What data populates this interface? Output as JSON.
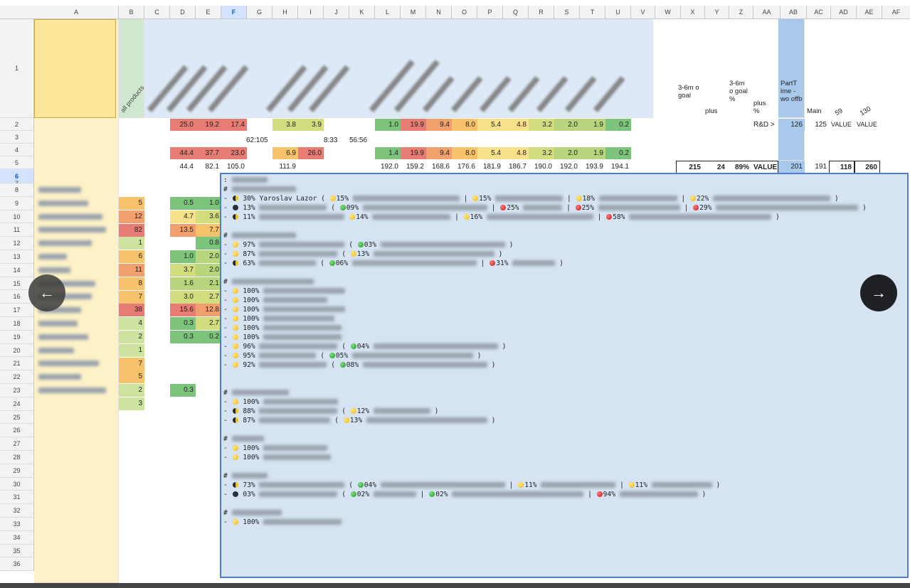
{
  "columns": [
    "A",
    "B",
    "C",
    "D",
    "E",
    "F",
    "G",
    "H",
    "I",
    "J",
    "K",
    "L",
    "M",
    "N",
    "O",
    "P",
    "Q",
    "R",
    "S",
    "T",
    "U",
    "V",
    "W",
    "X",
    "Y",
    "Z",
    "AA",
    "AB",
    "AC",
    "AD",
    "AE",
    "AF"
  ],
  "selected_column": "F",
  "rows": [
    "1",
    "2",
    "3",
    "4",
    "5",
    "6",
    "7",
    "8",
    "9",
    "10",
    "11",
    "12",
    "13",
    "14",
    "15",
    "16",
    "17",
    "18",
    "19",
    "20",
    "21",
    "22",
    "23",
    "24",
    "25",
    "26",
    "27",
    "28",
    "29",
    "30",
    "31",
    "32",
    "33",
    "34",
    "35",
    "36"
  ],
  "selected_row": "6",
  "header": {
    "b_rotated": "all products",
    "x": "3-6m o goal",
    "y": "plus",
    "z": "3-6m o goal %",
    "aa": "plus %",
    "ab": "PartT ime - wo offb",
    "ac": "Main",
    "ad": "59",
    "ae": "130"
  },
  "row2": {
    "values": [
      "25.0",
      "19.2",
      "17.4",
      "",
      "3.8",
      "3.9",
      "",
      "",
      "1.0",
      "19.9",
      "9.4",
      "8.0",
      "5.4",
      "4.8",
      "3.2",
      "2.0",
      "1.9",
      "0.2"
    ],
    "aa": "R&D >",
    "ab": "126",
    "ac": "125",
    "ad": "VALUE",
    "ae": "VALUE"
  },
  "row3": {
    "g": "62:105",
    "j": "8:33",
    "k": "56:56"
  },
  "row4": {
    "values": [
      "44.4",
      "37.7",
      "23.0",
      "",
      "6.9",
      "26.0",
      "",
      "",
      "1.4",
      "19.9",
      "9.4",
      "8.0",
      "5.4",
      "4.8",
      "3.2",
      "2.0",
      "1.9",
      "0.2"
    ]
  },
  "row5": {
    "values": [
      "44.4",
      "82.1",
      "105.0",
      "",
      "111.9",
      "",
      "",
      "",
      "192.0",
      "159.2",
      "168.6",
      "176.6",
      "181.9",
      "186.7",
      "190.0",
      "192.0",
      "193.9",
      "194.1"
    ],
    "x": "215",
    "y": "24",
    "z": "89%",
    "aa": "VALUE",
    "ab": "201",
    "ac": "191",
    "ad": "118",
    "ae": "260"
  },
  "b_values": [
    "5",
    "12",
    "82",
    "1",
    "6",
    "11",
    "8",
    "7",
    "38",
    "4",
    "2",
    "1",
    "7",
    "5",
    "2",
    "3"
  ],
  "d_values": [
    "0.5",
    "4.7",
    "13.5",
    "",
    "1.0",
    "3.7",
    "1.6",
    "3.0",
    "15.6",
    "0.3",
    "0.3",
    "",
    "",
    "",
    "0.3",
    ""
  ],
  "e_values": [
    "1.0",
    "3.6",
    "7.7",
    "0.8",
    "2.0",
    "2.0",
    "2.1",
    "2.7",
    "12.8",
    "2.7",
    "0.2",
    "",
    "",
    "",
    "",
    ""
  ],
  "popup": {
    "header": ":",
    "s1_title": "#",
    "s1_l1_pct": "30%",
    "s1_l1_name": "Yaroslav Lazor (",
    "s1_l1_a": "15%",
    "s1_l1_b": "15%",
    "s1_l1_c": "18%",
    "s1_l1_d": "22%",
    "s1_l2_pct": "13%",
    "s1_l2_a": "09%",
    "s1_l2_b": "25%",
    "s1_l2_c": "25%",
    "s1_l2_d": "29%",
    "s1_l3_pct": "11%",
    "s1_l3_a": "14%",
    "s1_l3_b": "16%",
    "s1_l3_c": "58%",
    "s2_l1_pct": "97%",
    "s2_l1_a": "03%",
    "s2_l2_pct": "87%",
    "s2_l2_a": "13%",
    "s2_l3_pct": "63%",
    "s2_l3_a": "06%",
    "s2_l3_b": "31%",
    "s3_l1": "100%",
    "s3_l2": "100%",
    "s3_l3": "100%",
    "s3_l4": "100%",
    "s3_l5": "100%",
    "s3_l6": "100%",
    "s3_l7_pct": "96%",
    "s3_l7_a": "04%",
    "s3_l8_pct": "95%",
    "s3_l8_a": "05%",
    "s3_l9_pct": "92%",
    "s3_l9_a": "08%",
    "s4_l1": "100%",
    "s4_l2_pct": "88%",
    "s4_l2_a": "12%",
    "s4_l3_pct": "87%",
    "s4_l3_a": "13%",
    "s5_l1": "100%",
    "s5_l2": "100%",
    "s6_l1_pct": "73%",
    "s6_l1_a": "04%",
    "s6_l1_b": "11%",
    "s6_l1_c": "11%",
    "s6_l2_pct": "03%",
    "s6_l2_a": "02%",
    "s6_l2_b": "02%",
    "s6_l2_c": "94%",
    "s7_l1": "100%"
  },
  "nav": {
    "prev_icon": "arrow-left-icon",
    "next_icon": "arrow-right-icon",
    "next_glyph": "→"
  },
  "colors": {
    "selection": "#4a7fd4",
    "popup_bg": "#d5e3f3",
    "heat_red": "#e67c73",
    "heat_yellow": "#f7e08a",
    "heat_green": "#7cc37c"
  }
}
